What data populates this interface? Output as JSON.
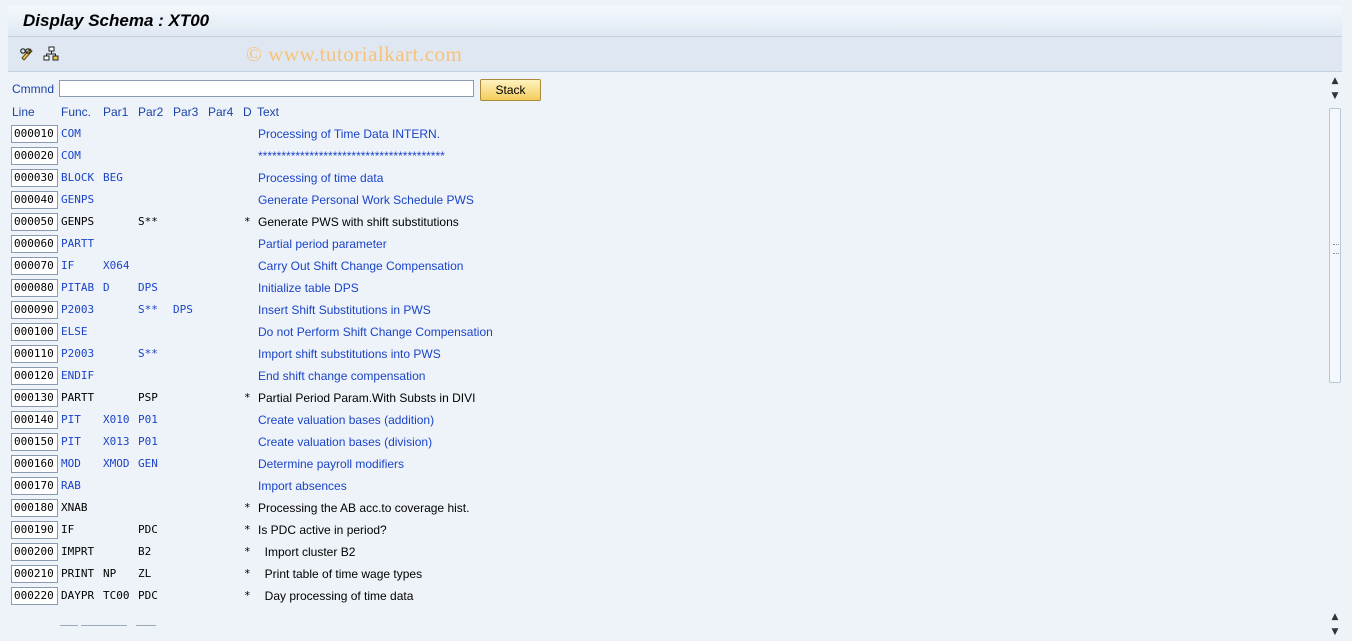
{
  "window": {
    "title": "Display Schema : XT00"
  },
  "toolbar": {
    "icons": [
      "pencil-glasses-icon",
      "hierarchy-icon"
    ]
  },
  "watermark": "© www.tutorialkart.com",
  "command": {
    "label": "Cmmnd",
    "value": "",
    "stack_label": "Stack"
  },
  "columns": {
    "line": "Line",
    "func": "Func.",
    "par1": "Par1",
    "par2": "Par2",
    "par3": "Par3",
    "par4": "Par4",
    "d": "D",
    "text": "Text"
  },
  "rows": [
    {
      "line": "000010",
      "func": "COM",
      "par1": "",
      "par2": "",
      "par3": "",
      "par4": "",
      "d": "",
      "text": "Processing of Time Data INTERN.",
      "color": "#1b44c8"
    },
    {
      "line": "000020",
      "func": "COM",
      "par1": "",
      "par2": "",
      "par3": "",
      "par4": "",
      "d": "",
      "text": "****************************************",
      "color": "#1b44c8"
    },
    {
      "line": "000030",
      "func": "BLOCK",
      "par1": "BEG",
      "par2": "",
      "par3": "",
      "par4": "",
      "d": "",
      "text": "Processing of time data",
      "color": "#1b44c8"
    },
    {
      "line": "000040",
      "func": "GENPS",
      "par1": "",
      "par2": "",
      "par3": "",
      "par4": "",
      "d": "",
      "text": "Generate Personal Work Schedule PWS",
      "color": "#1b44c8"
    },
    {
      "line": "000050",
      "func": "GENPS",
      "par1": "",
      "par2": "S**",
      "par3": "",
      "par4": "",
      "d": "*",
      "text": "Generate PWS with shift substitutions",
      "color": "#000000"
    },
    {
      "line": "000060",
      "func": "PARTT",
      "par1": "",
      "par2": "",
      "par3": "",
      "par4": "",
      "d": "",
      "text": "Partial period parameter",
      "color": "#1b44c8"
    },
    {
      "line": "000070",
      "func": "IF",
      "par1": "X064",
      "par2": "",
      "par3": "",
      "par4": "",
      "d": "",
      "text": "Carry Out Shift Change Compensation",
      "color": "#1b44c8"
    },
    {
      "line": "000080",
      "func": "PITAB",
      "par1": "D",
      "par2": "DPS",
      "par3": "",
      "par4": "",
      "d": "",
      "text": "Initialize table DPS",
      "color": "#1b44c8"
    },
    {
      "line": "000090",
      "func": "P2003",
      "par1": "",
      "par2": "S**",
      "par3": "DPS",
      "par4": "",
      "d": "",
      "text": "Insert Shift Substitutions in PWS",
      "color": "#1b44c8"
    },
    {
      "line": "000100",
      "func": "ELSE",
      "par1": "",
      "par2": "",
      "par3": "",
      "par4": "",
      "d": "",
      "text": "Do not Perform Shift Change Compensation",
      "color": "#1b44c8"
    },
    {
      "line": "000110",
      "func": "P2003",
      "par1": "",
      "par2": "S**",
      "par3": "",
      "par4": "",
      "d": "",
      "text": "Import shift substitutions into PWS",
      "color": "#1b44c8"
    },
    {
      "line": "000120",
      "func": "ENDIF",
      "par1": "",
      "par2": "",
      "par3": "",
      "par4": "",
      "d": "",
      "text": "End shift change compensation",
      "color": "#1b44c8"
    },
    {
      "line": "000130",
      "func": "PARTT",
      "par1": "",
      "par2": "PSP",
      "par3": "",
      "par4": "",
      "d": "*",
      "text": "Partial Period Param.With Substs in DIVI",
      "color": "#000000"
    },
    {
      "line": "000140",
      "func": "PIT",
      "par1": "X010",
      "par2": "P01",
      "par3": "",
      "par4": "",
      "d": "",
      "text": "Create valuation bases (addition)",
      "color": "#1b44c8"
    },
    {
      "line": "000150",
      "func": "PIT",
      "par1": "X013",
      "par2": "P01",
      "par3": "",
      "par4": "",
      "d": "",
      "text": "Create valuation bases (division)",
      "color": "#1b44c8"
    },
    {
      "line": "000160",
      "func": "MOD",
      "par1": "XMOD",
      "par2": "GEN",
      "par3": "",
      "par4": "",
      "d": "",
      "text": "Determine payroll modifiers",
      "color": "#1b44c8"
    },
    {
      "line": "000170",
      "func": "RAB",
      "par1": "",
      "par2": "",
      "par3": "",
      "par4": "",
      "d": "",
      "text": "Import absences",
      "color": "#1b44c8"
    },
    {
      "line": "000180",
      "func": "XNAB",
      "par1": "",
      "par2": "",
      "par3": "",
      "par4": "",
      "d": "*",
      "text": "Processing the AB acc.to coverage hist.",
      "color": "#000000"
    },
    {
      "line": "000190",
      "func": "IF",
      "par1": "",
      "par2": "PDC",
      "par3": "",
      "par4": "",
      "d": "*",
      "text": "Is PDC active in period?",
      "color": "#000000"
    },
    {
      "line": "000200",
      "func": "IMPRT",
      "par1": "",
      "par2": "B2",
      "par3": "",
      "par4": "",
      "d": "*",
      "text": "  Import cluster B2",
      "color": "#000000"
    },
    {
      "line": "000210",
      "func": "PRINT",
      "par1": "NP",
      "par2": "ZL",
      "par3": "",
      "par4": "",
      "d": "*",
      "text": "  Print table of time wage types",
      "color": "#000000"
    },
    {
      "line": "000220",
      "func": "DAYPR",
      "par1": "TC00",
      "par2": "PDC",
      "par3": "",
      "par4": "",
      "d": "*",
      "text": "  Day processing of time data",
      "color": "#000000"
    }
  ]
}
